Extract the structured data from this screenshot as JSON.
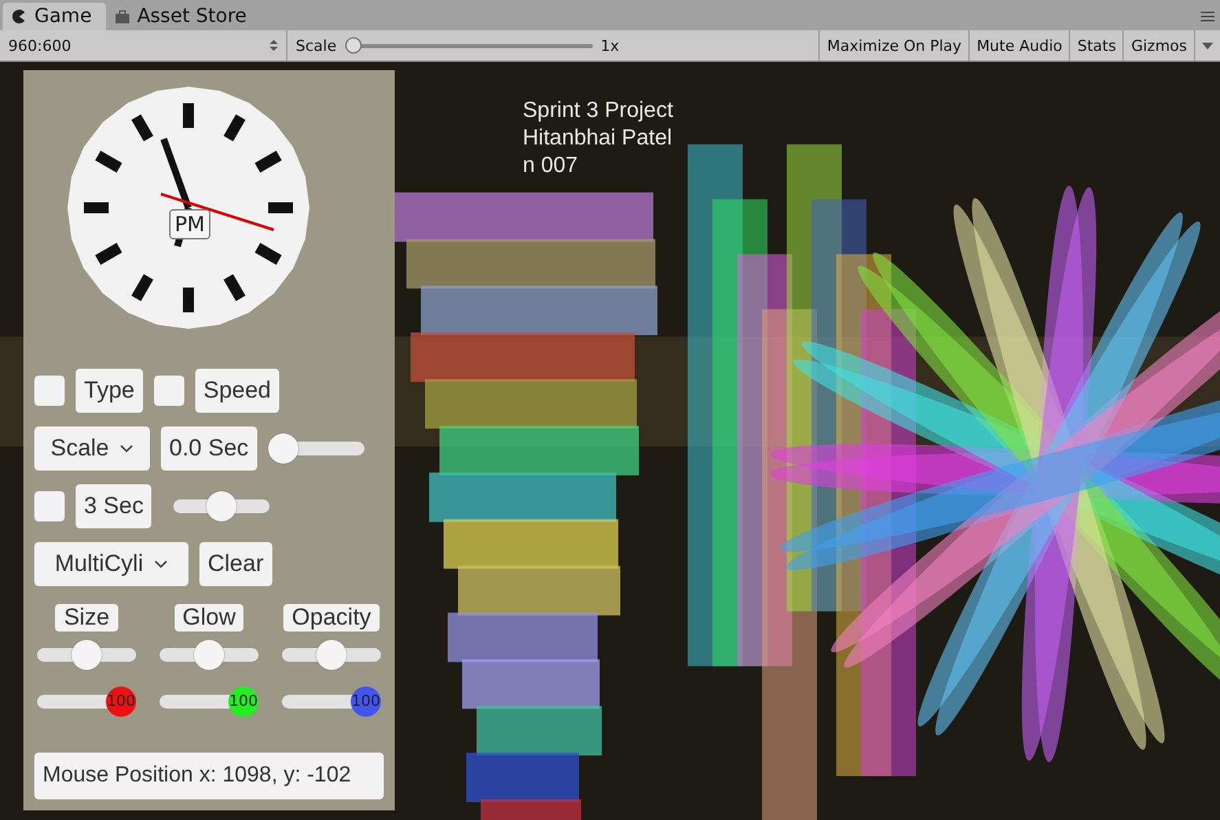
{
  "window_tabs": [
    {
      "label": "Game",
      "selected": true
    },
    {
      "label": "Asset Store",
      "selected": false
    }
  ],
  "toolbar": {
    "resolution": "960:600",
    "scale_label": "Scale",
    "scale_slider": {
      "level": 0
    },
    "scale_value": "1x",
    "buttons": [
      "Maximize On Play",
      "Mute Audio",
      "Stats"
    ],
    "gizmos": "Gizmos"
  },
  "overlay_text": [
    "Sprint 3 Project",
    "Hitanbhai Patel",
    "n 007"
  ],
  "panel": {
    "clock": {
      "label": "PM"
    },
    "type_toggle": {
      "checked": false,
      "label": "Type"
    },
    "speed_toggle": {
      "checked": false,
      "label": "Speed"
    },
    "scale_dropdown": "Scale",
    "time_button": "0.0 Sec",
    "time_slider": {
      "level": 0
    },
    "interval_toggle": {
      "checked": false,
      "label": "3 Sec"
    },
    "interval_slider": {
      "level": 0.5
    },
    "shape_dropdown": "MultiCyli",
    "clear_button": "Clear",
    "property_sliders": [
      {
        "label": "Size",
        "level": 0.5
      },
      {
        "label": "Glow",
        "level": 0.5
      },
      {
        "label": "Opacity",
        "level": 0.5
      }
    ],
    "color_sliders": [
      {
        "value": "100",
        "level": 1,
        "color": "#ee1111"
      },
      {
        "value": "100",
        "level": 1,
        "color": "#22ee22"
      },
      {
        "value": "100",
        "level": 1,
        "color": "#4455ee"
      }
    ],
    "mouse_position": "Mouse Position x: 1098, y: -102"
  }
}
